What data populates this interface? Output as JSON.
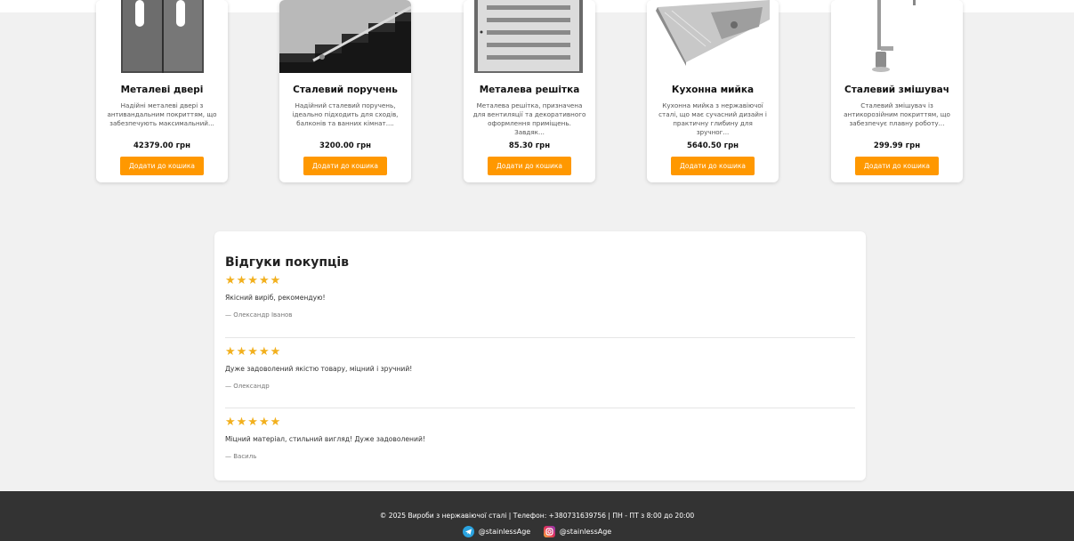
{
  "products": [
    {
      "name": "Металеві двері",
      "description": "Надійні металеві двері з антивандальним покриттям, що забезпечують максимальний...",
      "price": "42379.00 грн",
      "button": "Додати до кошика",
      "image_icon": "metal-door-image"
    },
    {
      "name": "Сталевий поручень",
      "description": "Надійний сталевий поручень, ідеально підходить для сходів, балконів та ванних кімнат....",
      "price": "3200.00 грн",
      "button": "Додати до кошика",
      "image_icon": "steel-handrail-image"
    },
    {
      "name": "Металева решітка",
      "description": "Металева решітка, призначена для вентиляції та декоративного оформлення приміщень. Завдяк...",
      "price": "85.30 грн",
      "button": "Додати до кошика",
      "image_icon": "metal-grille-image"
    },
    {
      "name": "Кухонна мийка",
      "description": "Кухонна мийка з нержавіючої сталі, що має сучасний дизайн і практичну глибину для зручног...",
      "price": "5640.50 грн",
      "button": "Додати до кошика",
      "image_icon": "kitchen-sink-image"
    },
    {
      "name": "Сталевий змішувач",
      "description": "Сталевий змішувач із антикорозійним покриттям, що забезпечує плавну роботу...",
      "price": "299.99 грн",
      "button": "Додати до кошика",
      "image_icon": "steel-faucet-image"
    }
  ],
  "reviews": {
    "title": "Відгуки покупців",
    "items": [
      {
        "stars": "★★★★★",
        "rating": 5,
        "text": "Якісний виріб, рекомендую!",
        "author": "— Олександр Іванов"
      },
      {
        "stars": "★★★★★",
        "rating": 5,
        "text": "Дуже задоволений якістю товару, міцний і зручний!",
        "author": "— Олександр"
      },
      {
        "stars": "★★★★★",
        "rating": 5,
        "text": "Міцний матеріал, стильний вигляд! Дуже задоволений!",
        "author": "— Василь"
      }
    ]
  },
  "footer": {
    "info": "© 2025 Вироби з нержавіючої сталі | Телефон: +380731639756 | ПН - ПТ з 8:00 до 20:00",
    "telegram": "@stainlessAge",
    "instagram": "@stainlessAge"
  },
  "colors": {
    "accent": "#ff9800",
    "star": "#f2b01e",
    "footer_bg": "#333333",
    "telegram": "#2aa3e0"
  }
}
